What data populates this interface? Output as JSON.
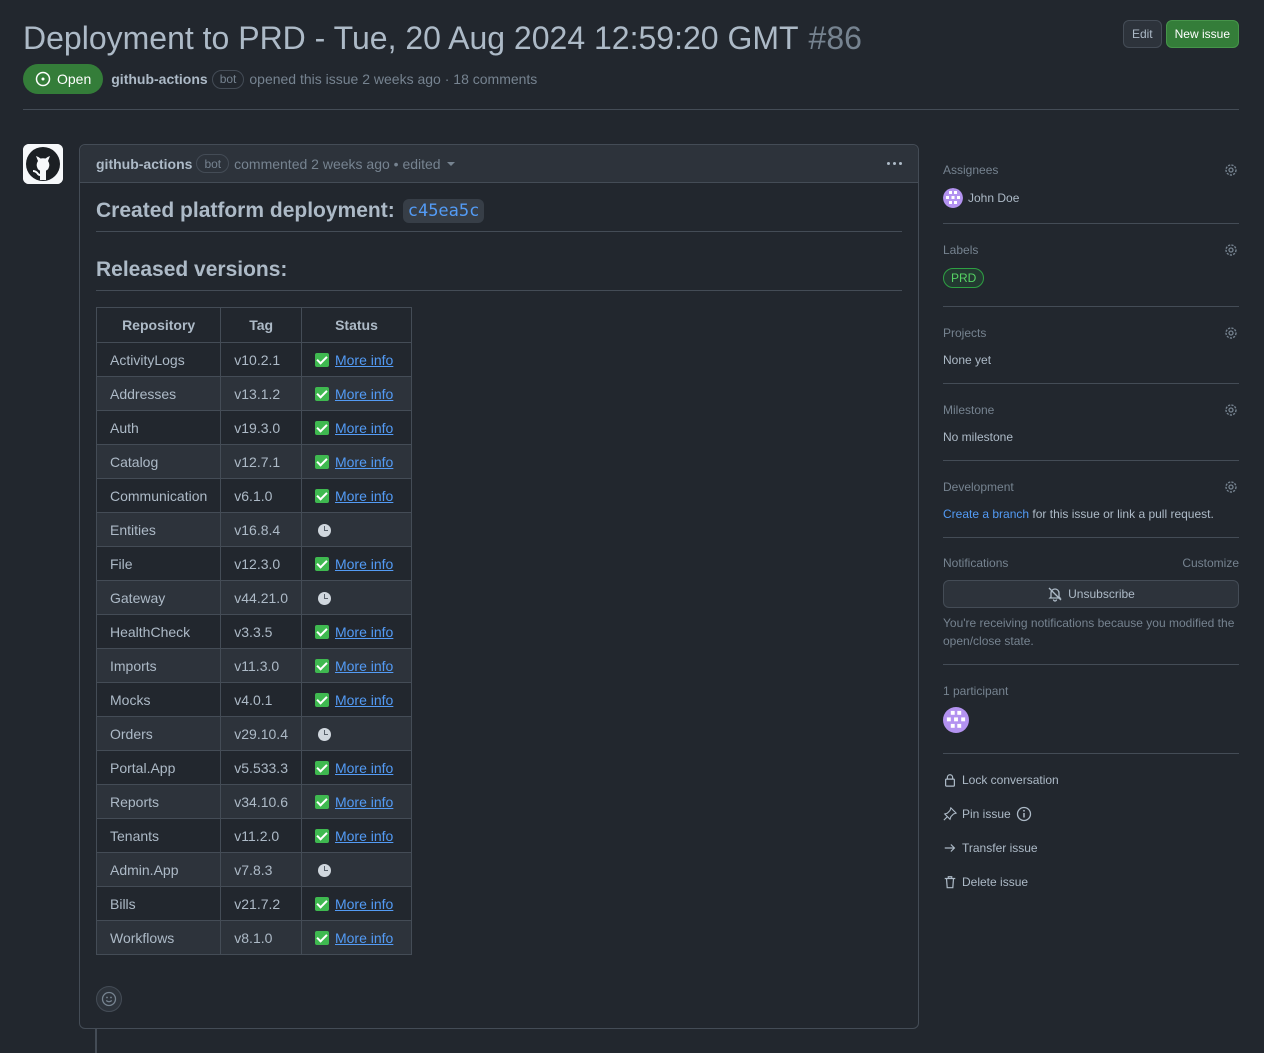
{
  "header": {
    "title": "Deployment to PRD - Tue, 20 Aug 2024 12:59:20 GMT",
    "number": "#86",
    "edit_label": "Edit",
    "new_issue_label": "New issue",
    "state": "Open",
    "author": "github-actions",
    "bot": "bot",
    "meta": "opened this issue 2 weeks ago · 18 comments"
  },
  "comment": {
    "author": "github-actions",
    "bot": "bot",
    "meta": "commented 2 weeks ago • edited",
    "heading1": "Created platform deployment:",
    "commit": "c45ea5c",
    "heading2": "Released versions:",
    "columns": [
      "Repository",
      "Tag",
      "Status"
    ],
    "more_info": "More info",
    "rows": [
      {
        "repo": "ActivityLogs",
        "tag": "v10.2.1",
        "status": "done"
      },
      {
        "repo": "Addresses",
        "tag": "v13.1.2",
        "status": "done"
      },
      {
        "repo": "Auth",
        "tag": "v19.3.0",
        "status": "done"
      },
      {
        "repo": "Catalog",
        "tag": "v12.7.1",
        "status": "done"
      },
      {
        "repo": "Communication",
        "tag": "v6.1.0",
        "status": "done"
      },
      {
        "repo": "Entities",
        "tag": "v16.8.4",
        "status": "pending"
      },
      {
        "repo": "File",
        "tag": "v12.3.0",
        "status": "done"
      },
      {
        "repo": "Gateway",
        "tag": "v44.21.0",
        "status": "pending"
      },
      {
        "repo": "HealthCheck",
        "tag": "v3.3.5",
        "status": "done"
      },
      {
        "repo": "Imports",
        "tag": "v11.3.0",
        "status": "done"
      },
      {
        "repo": "Mocks",
        "tag": "v4.0.1",
        "status": "done"
      },
      {
        "repo": "Orders",
        "tag": "v29.10.4",
        "status": "pending"
      },
      {
        "repo": "Portal.App",
        "tag": "v5.533.3",
        "status": "done"
      },
      {
        "repo": "Reports",
        "tag": "v34.10.6",
        "status": "done"
      },
      {
        "repo": "Tenants",
        "tag": "v11.2.0",
        "status": "done"
      },
      {
        "repo": "Admin.App",
        "tag": "v7.8.3",
        "status": "pending"
      },
      {
        "repo": "Bills",
        "tag": "v21.7.2",
        "status": "done"
      },
      {
        "repo": "Workflows",
        "tag": "v8.1.0",
        "status": "done"
      }
    ]
  },
  "sidebar": {
    "assignees_title": "Assignees",
    "assignee_name": "John Doe",
    "labels_title": "Labels",
    "label_prd": "PRD",
    "projects_title": "Projects",
    "projects_value": "None yet",
    "milestone_title": "Milestone",
    "milestone_value": "No milestone",
    "development_title": "Development",
    "development_link": "Create a branch",
    "development_text": "for this issue or link a pull request.",
    "notifications_title": "Notifications",
    "customize": "Customize",
    "unsubscribe": "Unsubscribe",
    "notif_note": "You're receiving notifications because you modified the open/close state.",
    "participants": "1 participant",
    "lock": "Lock conversation",
    "pin": "Pin issue",
    "transfer": "Transfer issue",
    "delete": "Delete issue"
  },
  "colors": {
    "background": "#22272e",
    "open_green": "#347d39",
    "link_blue": "#539bf5",
    "border": "#444c56"
  }
}
